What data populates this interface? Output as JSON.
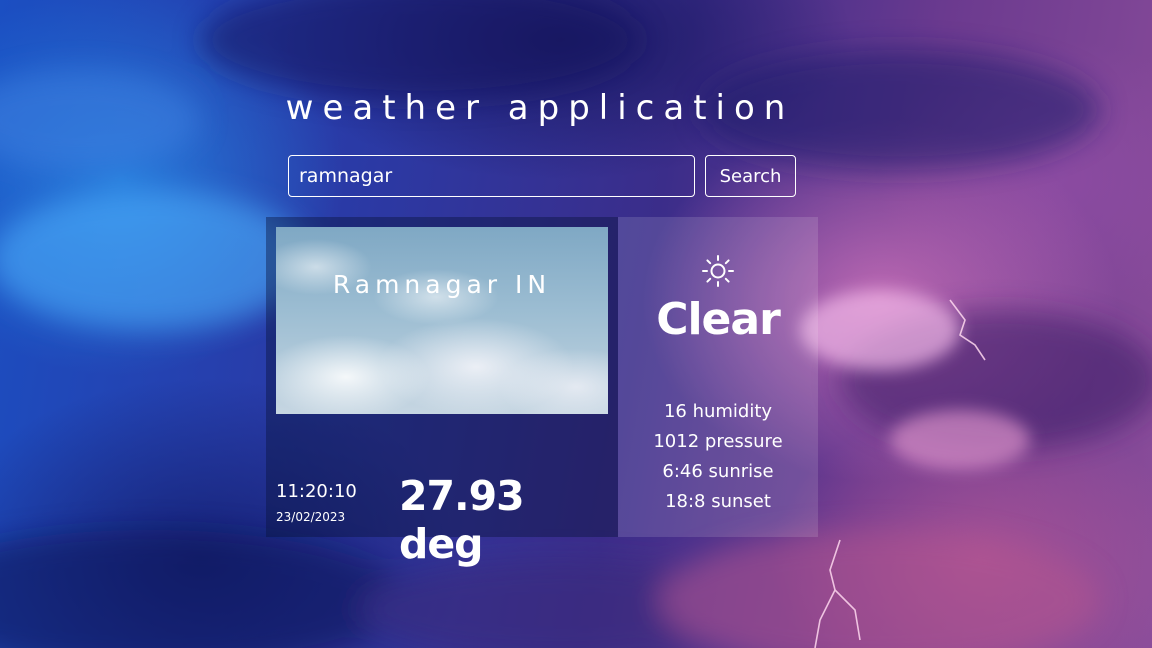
{
  "header": {
    "title": "weather application"
  },
  "search": {
    "value": "ramnagar",
    "button_label": "Search"
  },
  "weather": {
    "city": "Ramnagar IN",
    "time": "11:20:10",
    "date": "23/02/2023",
    "temperature": "27.93 deg",
    "condition": "Clear",
    "condition_icon": "sun-icon",
    "stats": [
      "16 humidity",
      "1012 pressure",
      "6:46 sunrise",
      "18:8 sunset"
    ]
  },
  "colors": {
    "text": "#ffffff",
    "background_blue": "#1b4fc2",
    "background_purple": "#6b3a8f"
  }
}
